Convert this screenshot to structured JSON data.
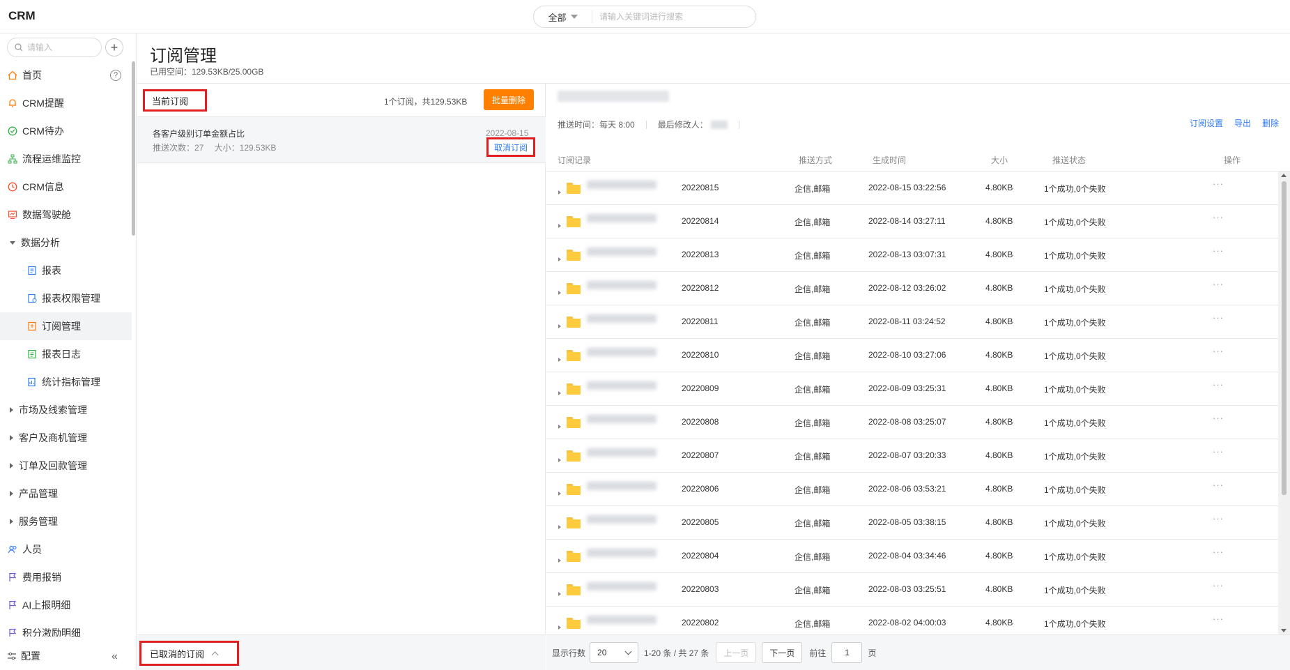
{
  "app": {
    "title": "CRM"
  },
  "search": {
    "scope": "全部",
    "placeholder": "请输入关键词进行搜索"
  },
  "sidebar": {
    "search_placeholder": "请输入",
    "items": [
      {
        "label": "首页",
        "icon": "home-icon",
        "color": "#ff7a00"
      },
      {
        "label": "CRM提醒",
        "icon": "bell-icon",
        "color": "#ff7a00"
      },
      {
        "label": "CRM待办",
        "icon": "check-circle-icon",
        "color": "#2fb344"
      },
      {
        "label": "流程运维监控",
        "icon": "flow-icon",
        "color": "#2fb344"
      },
      {
        "label": "CRM信息",
        "icon": "clock-icon",
        "color": "#ff4d2e"
      },
      {
        "label": "数据驾驶舱",
        "icon": "dashboard-icon",
        "color": "#ff4d2e"
      },
      {
        "label": "数据分析",
        "expanded": true
      },
      {
        "label": "报表",
        "icon": "report-icon",
        "color": "#2f7cf6"
      },
      {
        "label": "报表权限管理",
        "icon": "report-permission-icon",
        "color": "#2f7cf6"
      },
      {
        "label": "订阅管理",
        "icon": "subscription-icon",
        "color": "#ff7a00"
      },
      {
        "label": "报表日志",
        "icon": "log-icon",
        "color": "#2fb344"
      },
      {
        "label": "统计指标管理",
        "icon": "metric-icon",
        "color": "#2f7cf6"
      },
      {
        "label": "市场及线索管理"
      },
      {
        "label": "客户及商机管理"
      },
      {
        "label": "订单及回款管理"
      },
      {
        "label": "产品管理"
      },
      {
        "label": "服务管理"
      },
      {
        "label": "人员",
        "icon": "people-icon",
        "color": "#2f7cf6"
      },
      {
        "label": "费用报销",
        "icon": "flag-icon",
        "color": "#6b5bd6"
      },
      {
        "label": "AI上报明细",
        "icon": "flag-icon",
        "color": "#6b5bd6"
      },
      {
        "label": "积分激励明细",
        "icon": "flag-icon",
        "color": "#6b5bd6"
      }
    ],
    "config_label": "配置"
  },
  "page": {
    "title": "订阅管理",
    "used_space": "已用空间：129.53KB/25.00GB"
  },
  "left": {
    "current_tab": "当前订阅",
    "count_text": "1个订阅，共129.53KB",
    "bulk_delete": "批量删除",
    "subscription": {
      "name": "各客户级别订单金额占比",
      "meta": "推送次数：27　 大小：129.53KB",
      "date": "2022-08-15",
      "cancel": "取消订阅"
    },
    "cancelled_label": "已取消的订阅"
  },
  "right": {
    "push_time": "推送时间：每天 8:00",
    "last_modifier": "最后修改人：",
    "actions": [
      "订阅设置",
      "导出",
      "删除"
    ],
    "columns": [
      "订阅记录",
      "推送方式",
      "生成时间",
      "大小",
      "推送状态",
      "操作"
    ],
    "rows": [
      {
        "suffix": "20220815",
        "method": "企信,邮箱",
        "time": "2022-08-15 03:22:56",
        "size": "4.80KB",
        "status": "1个成功,0个失败",
        "op": "···"
      },
      {
        "suffix": "20220814",
        "method": "企信,邮箱",
        "time": "2022-08-14 03:27:11",
        "size": "4.80KB",
        "status": "1个成功,0个失败",
        "op": "···"
      },
      {
        "suffix": "20220813",
        "method": "企信,邮箱",
        "time": "2022-08-13 03:07:31",
        "size": "4.80KB",
        "status": "1个成功,0个失败",
        "op": "···"
      },
      {
        "suffix": "20220812",
        "method": "企信,邮箱",
        "time": "2022-08-12 03:26:02",
        "size": "4.80KB",
        "status": "1个成功,0个失败",
        "op": "···"
      },
      {
        "suffix": "20220811",
        "method": "企信,邮箱",
        "time": "2022-08-11 03:24:52",
        "size": "4.80KB",
        "status": "1个成功,0个失败",
        "op": "···"
      },
      {
        "suffix": "20220810",
        "method": "企信,邮箱",
        "time": "2022-08-10 03:27:06",
        "size": "4.80KB",
        "status": "1个成功,0个失败",
        "op": "···"
      },
      {
        "suffix": "20220809",
        "method": "企信,邮箱",
        "time": "2022-08-09 03:25:31",
        "size": "4.80KB",
        "status": "1个成功,0个失败",
        "op": "···"
      },
      {
        "suffix": "20220808",
        "method": "企信,邮箱",
        "time": "2022-08-08 03:25:07",
        "size": "4.80KB",
        "status": "1个成功,0个失败",
        "op": "···"
      },
      {
        "suffix": "20220807",
        "method": "企信,邮箱",
        "time": "2022-08-07 03:20:33",
        "size": "4.80KB",
        "status": "1个成功,0个失败",
        "op": "···"
      },
      {
        "suffix": "20220806",
        "method": "企信,邮箱",
        "time": "2022-08-06 03:53:21",
        "size": "4.80KB",
        "status": "1个成功,0个失败",
        "op": "···"
      },
      {
        "suffix": "20220805",
        "method": "企信,邮箱",
        "time": "2022-08-05 03:38:15",
        "size": "4.80KB",
        "status": "1个成功,0个失败",
        "op": "···"
      },
      {
        "suffix": "20220804",
        "method": "企信,邮箱",
        "time": "2022-08-04 03:34:46",
        "size": "4.80KB",
        "status": "1个成功,0个失败",
        "op": "···"
      },
      {
        "suffix": "20220803",
        "method": "企信,邮箱",
        "time": "2022-08-03 03:25:51",
        "size": "4.80KB",
        "status": "1个成功,0个失败",
        "op": "···"
      },
      {
        "suffix": "20220802",
        "method": "企信,邮箱",
        "time": "2022-08-02 04:00:03",
        "size": "4.80KB",
        "status": "1个成功,0个失败",
        "op": "···"
      }
    ],
    "pager": {
      "rows_label": "显示行数",
      "page_size": "20",
      "range": "1-20 条 / 共 27 条",
      "prev": "上一页",
      "next": "下一页",
      "goto": "前往",
      "page": "1",
      "page_unit": "页"
    }
  },
  "colors": {
    "accent": "#ff8000",
    "link": "#2f7cf6",
    "highlight_box": "#e02020"
  }
}
